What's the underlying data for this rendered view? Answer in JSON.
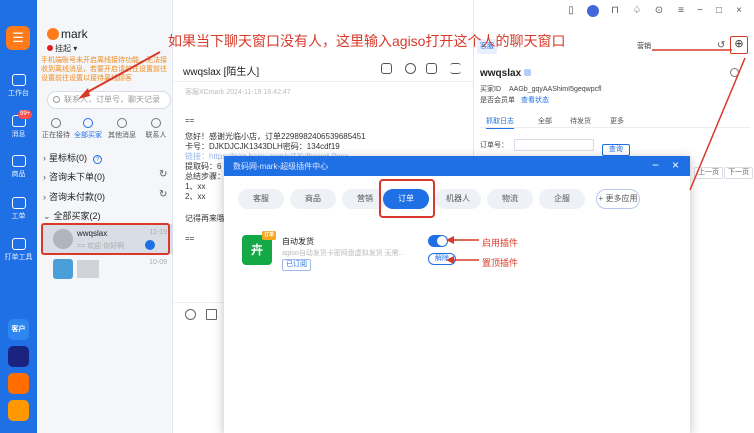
{
  "rail": {
    "logo_glyph": "☰",
    "items": [
      {
        "label": "工作台"
      },
      {
        "label": "消息",
        "badge": "99+"
      },
      {
        "label": "商品"
      },
      {
        "label": "工单"
      },
      {
        "label": "打单工具"
      }
    ],
    "apps": [
      {
        "label": "客户"
      },
      {
        "label": ""
      },
      {
        "label": ""
      },
      {
        "label": ""
      }
    ]
  },
  "account": {
    "name": "mark",
    "status": "挂起"
  },
  "notice": "手机端账号未开启离线接待功能，无法接收到离线消息，若要开启请前往设置前往设置前往设置以接待离线顾客",
  "search": {
    "placeholder": "联系人，订单号，聊天记录"
  },
  "filter_tabs": [
    {
      "label": "正在接待"
    },
    {
      "label": "全部买家"
    },
    {
      "label": "其他消息"
    },
    {
      "label": "联系人"
    }
  ],
  "groups": [
    {
      "label": "星标标(0)"
    },
    {
      "label": "咨询未下单(0)"
    },
    {
      "label": "咨询未付款(0)"
    },
    {
      "label": "全部买家(2)"
    }
  ],
  "contacts": [
    {
      "name": "wwqslax",
      "msg": "== 欢迎 你好啊",
      "time": "11-19"
    },
    {
      "name": "",
      "msg": "",
      "time": "10-09"
    }
  ],
  "chat": {
    "title": "wwqslax [陌生人]",
    "meta": "客服XCmark 2024-11-19 16:42:47",
    "lines": [
      "==",
      "您好！感谢光临小店，订单2298982406539685451",
      "卡号：DJKDJCJK1343DLH密码：134cdf19",
      "链接：https://gao.baisy.com/s/1Xv8xvwd-0osx",
      "提取码：6",
      "总结步骤：",
      "1、xx",
      "2、xx",
      "记得再来哦",
      "=="
    ]
  },
  "info": {
    "tabs": [
      "客服",
      "营销"
    ],
    "buyer": "wwqslax",
    "buyer_id_label": "买家ID",
    "buyer_id": "AAGb_gqyAAShimI5geqwpcfl",
    "member_label": "是否会员单",
    "member_link": "查看状态",
    "subtabs": [
      "抓取日志",
      "全部",
      "待发货",
      "更多"
    ],
    "order_label": "订单号：",
    "query_btn": "查询",
    "prev_btn": "上一页",
    "next_btn": "下一页"
  },
  "modal": {
    "title": "数码网-mark-超级插件中心",
    "categories": [
      "客服",
      "商品",
      "营销",
      "订单",
      "机器人",
      "物流",
      "企服"
    ],
    "more": "+ 更多应用",
    "plugin": {
      "name": "自动发货",
      "desc": "agiso自动发货卡密网盘虚拟发货 无需...",
      "status": "已订阅",
      "corner": "订单",
      "unpin": "解除"
    }
  },
  "annotations": {
    "top": "如果当下聊天窗口没有人，这里输入agiso打开这个人的聊天窗口",
    "toggle": "启用插件",
    "unpin": "置顶插件"
  }
}
